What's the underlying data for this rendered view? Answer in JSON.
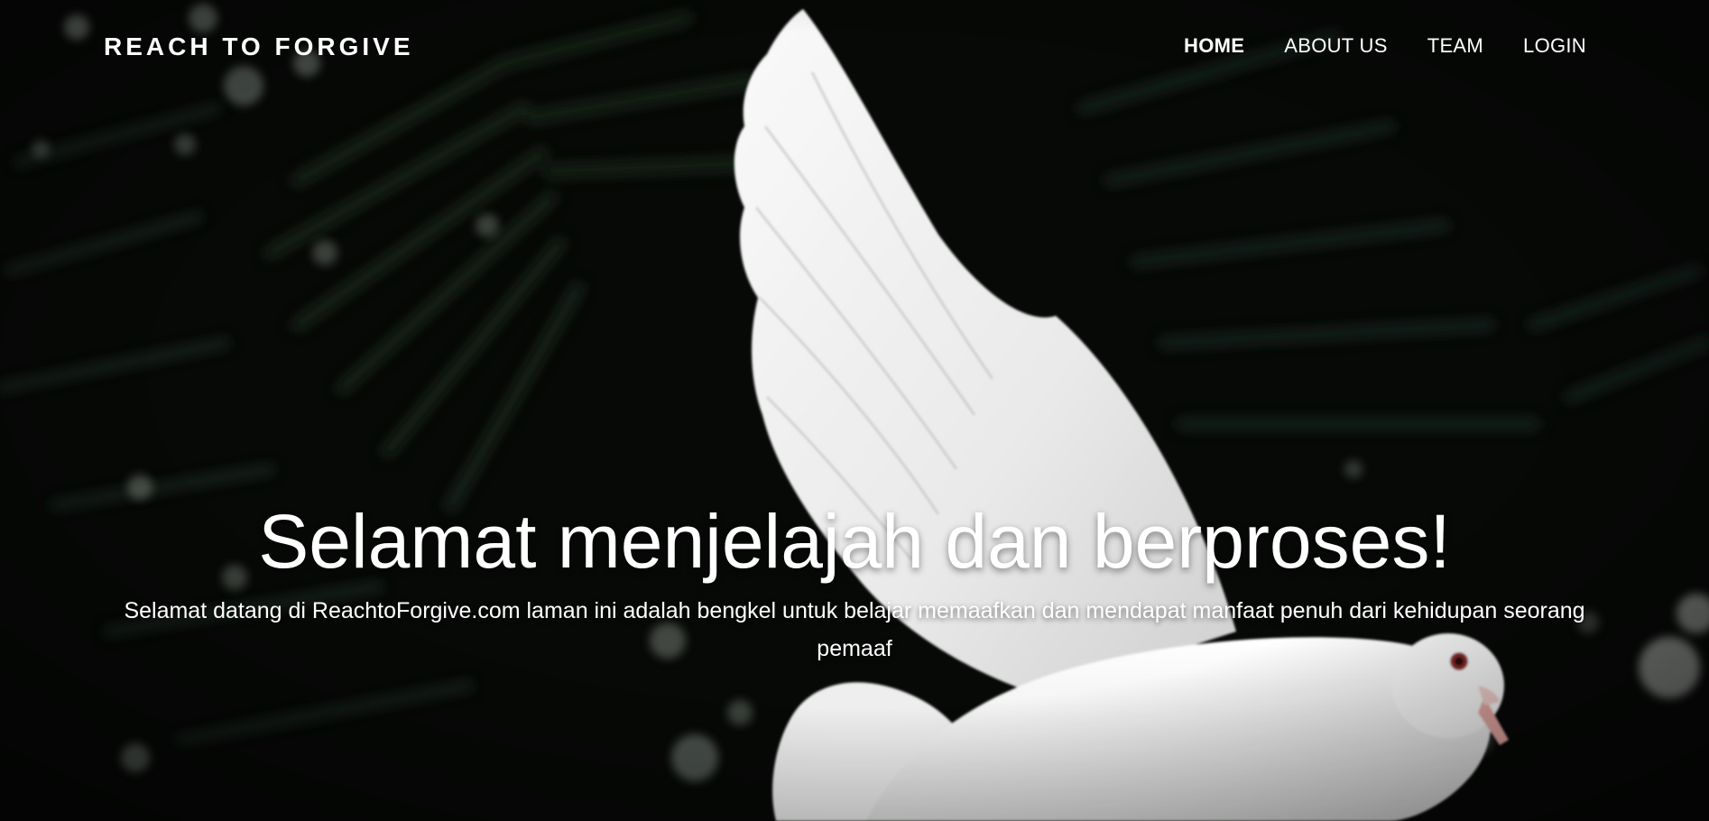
{
  "header": {
    "brand": "REACH TO FORGIVE",
    "nav": [
      {
        "label": "HOME",
        "active": true
      },
      {
        "label": "ABOUT US",
        "active": false
      },
      {
        "label": "TEAM",
        "active": false
      },
      {
        "label": "LOGIN",
        "active": false
      }
    ]
  },
  "hero": {
    "title": "Selamat menjelajah dan berproses!",
    "subtitle": "Selamat datang di ReachtoForgive.com laman ini adalah bengkel untuk belajar memaafkan dan mendapat manfaat penuh dari kehidupan seorang pemaaf"
  },
  "colors": {
    "background": "#060806",
    "text": "#ffffff",
    "dove": "#f2f2f2"
  }
}
